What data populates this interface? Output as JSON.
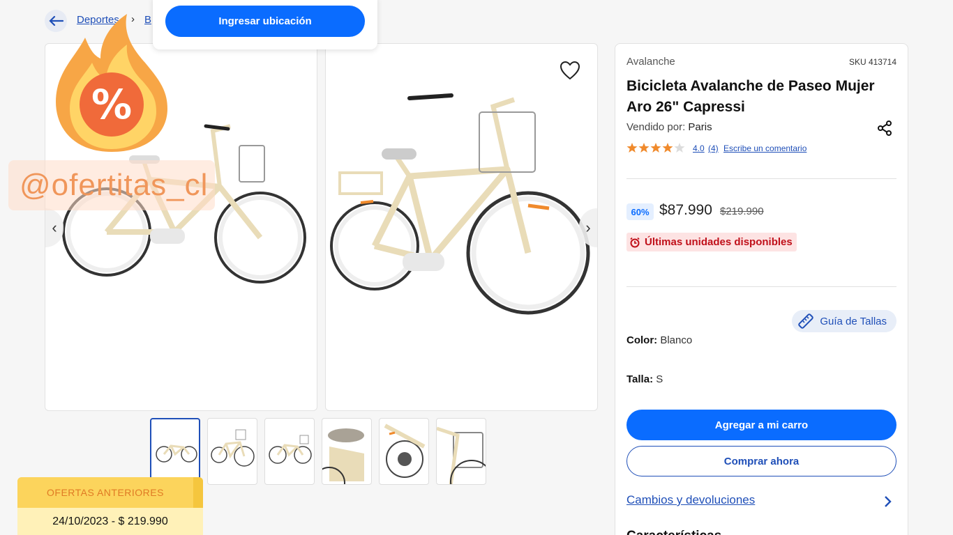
{
  "breadcrumb": {
    "items": [
      "Deportes",
      "B"
    ],
    "separator": "›"
  },
  "location_popup": {
    "button_label": "Ingresar ubicación"
  },
  "watermark": {
    "badge_symbol": "%",
    "handle": "@ofertitas_cl",
    "offers_title": "OFERTAS ANTERIORES",
    "offers_rows": [
      "24/10/2023  -  $ 219.990"
    ]
  },
  "product": {
    "brand": "Avalanche",
    "sku": "SKU 413714",
    "title": "Bicicleta Avalanche de Paseo Mujer Aro 26\" Capressi",
    "seller_label": "Vendido por:",
    "seller": "Paris",
    "rating": "4.0",
    "reviews": "(4)",
    "write_review": "Escribe un comentario",
    "stars_filled": 4,
    "stars_total": 5,
    "discount": "60%",
    "price": "$87.990",
    "old_price": "$219.990",
    "stock_notice": "Últimas unidades disponibles",
    "size_guide": "Guía de Tallas",
    "color_label": "Color:",
    "color_value": "Blanco",
    "size_label": "Talla:",
    "size_value": "S",
    "add_to_cart": "Agregar a mi carro",
    "buy_now": "Comprar ahora",
    "returns": "Cambios y devoluciones",
    "features_heading": "Características"
  },
  "gallery": {
    "thumbnail_count": 6,
    "active_thumbnail": 1
  },
  "colors": {
    "primary": "#0a6cff",
    "link": "#1f4fb8",
    "stock_red": "#c0101a",
    "star": "#f08a2c",
    "bike_cream": "#e9dcb8"
  },
  "icons": [
    "back-arrow-icon",
    "heart-icon",
    "share-icon",
    "star-icon",
    "alarm-icon",
    "ruler-icon",
    "chevron-right-icon",
    "chevron-left-icon",
    "flame-icon"
  ]
}
